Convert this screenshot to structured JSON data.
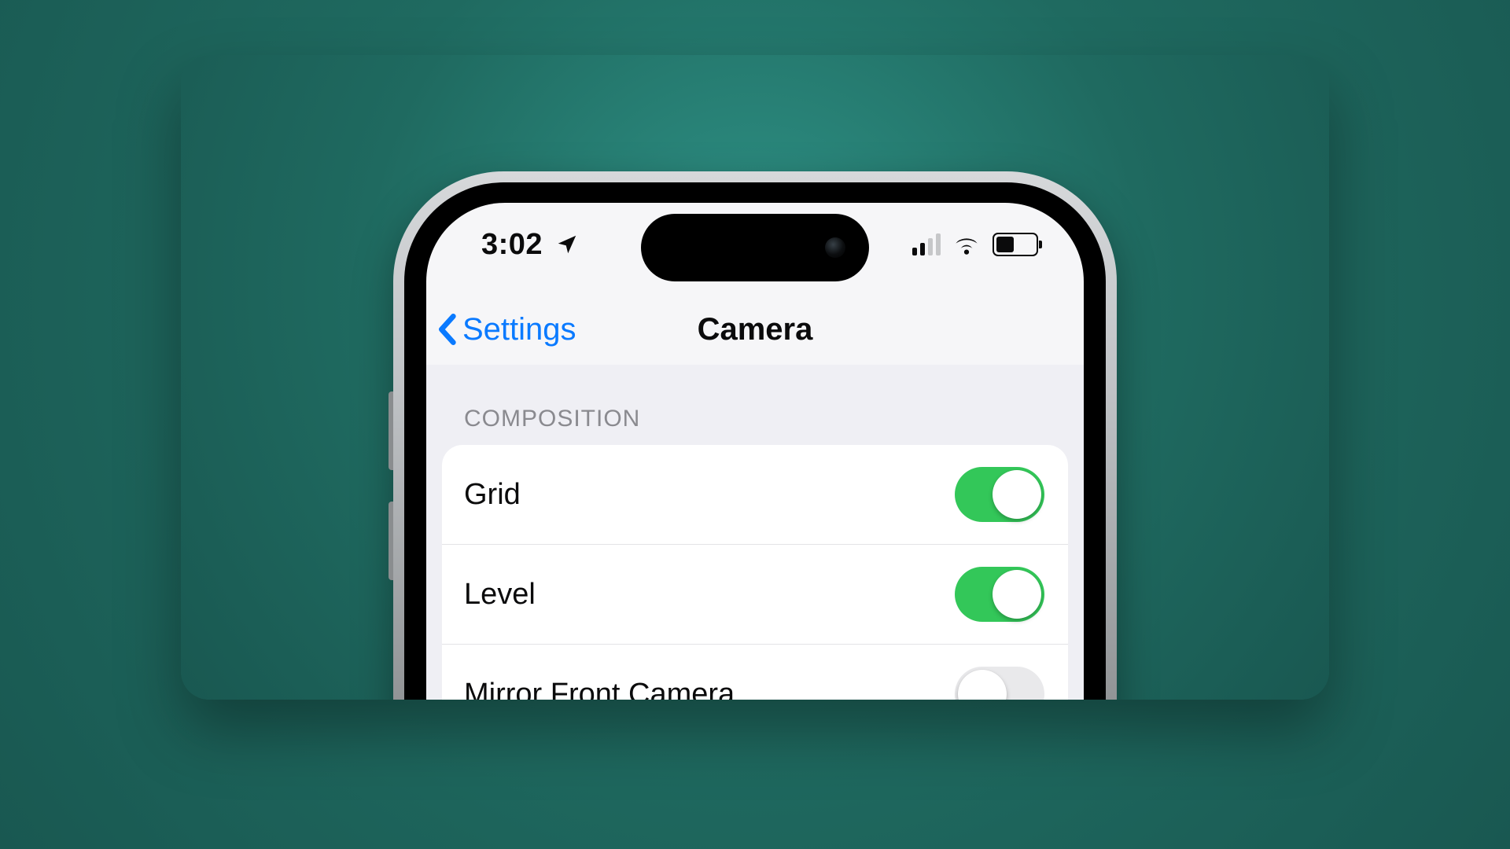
{
  "statusbar": {
    "time": "3:02"
  },
  "nav": {
    "back_label": "Settings",
    "title": "Camera"
  },
  "section": {
    "header": "COMPOSITION"
  },
  "rows": [
    {
      "label": "Grid",
      "on": true
    },
    {
      "label": "Level",
      "on": true
    },
    {
      "label": "Mirror Front Camera",
      "on": false
    }
  ]
}
